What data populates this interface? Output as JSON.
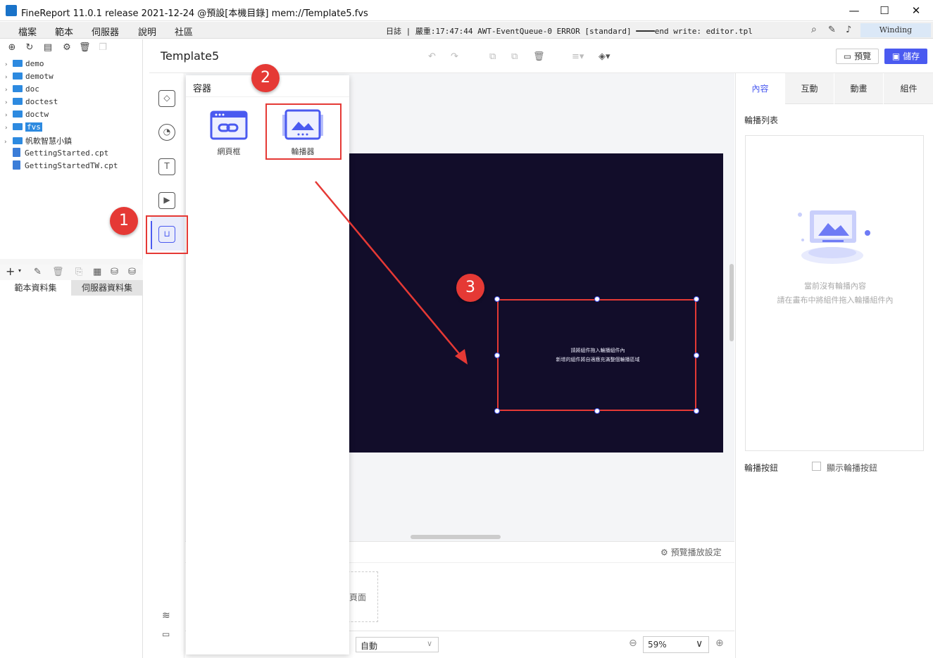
{
  "window": {
    "title": "FineReport 11.0.1 release 2021-12-24 @預設[本機目錄]    mem://Template5.fvs"
  },
  "menu": {
    "items": [
      "檔案",
      "範本",
      "伺服器",
      "說明",
      "社區"
    ],
    "log": "日誌 | 嚴重:17:47:44 AWT-EventQueue-0 ERROR [standard] ━━━━end write: editor.tpl",
    "winding": "Winding"
  },
  "tree": {
    "items": [
      {
        "type": "folder",
        "label": "demo"
      },
      {
        "type": "folder",
        "label": "demotw"
      },
      {
        "type": "folder",
        "label": "doc"
      },
      {
        "type": "folder",
        "label": "doctest"
      },
      {
        "type": "folder",
        "label": "doctw"
      },
      {
        "type": "folder",
        "label": "fvs",
        "selected": true
      },
      {
        "type": "folder",
        "label": "帆軟智慧小鎮"
      },
      {
        "type": "file",
        "label": "GettingStarted.cpt"
      },
      {
        "type": "file",
        "label": "GettingStartedTW.cpt"
      }
    ]
  },
  "dataset_tabs": [
    "範本資料集",
    "伺服器資料集"
  ],
  "toolbar": {
    "template_name": "Template5",
    "preview_label": "預覽",
    "save_label": "儲存"
  },
  "popup": {
    "title": "容器",
    "components": [
      "網頁框",
      "輪播器"
    ]
  },
  "canvas": {
    "placeholder_line1": "請將組件拖入輪播組件內",
    "placeholder_line2": "新增的組件將自適應充滿整個輪播區域"
  },
  "bottom": {
    "preview_settings": "預覽播放設定",
    "page_label": "頁面",
    "auto_select": "自動",
    "zoom": "59%"
  },
  "right_panel": {
    "tabs": [
      "內容",
      "互動",
      "動畫",
      "組件"
    ],
    "active_tab": "內容",
    "list_label": "輪播列表",
    "empty_line1": "當前沒有輪播內容",
    "empty_line2": "請在畫布中將組件拖入輪播組件內",
    "button_label": "輪播按鈕",
    "show_buttons_label": "顯示輪播按鈕"
  },
  "annotations": [
    "1",
    "2",
    "3"
  ],
  "colors": {
    "accent": "#4a5af0",
    "canvas_bg": "#120d2a",
    "highlight_red": "#e53935"
  }
}
